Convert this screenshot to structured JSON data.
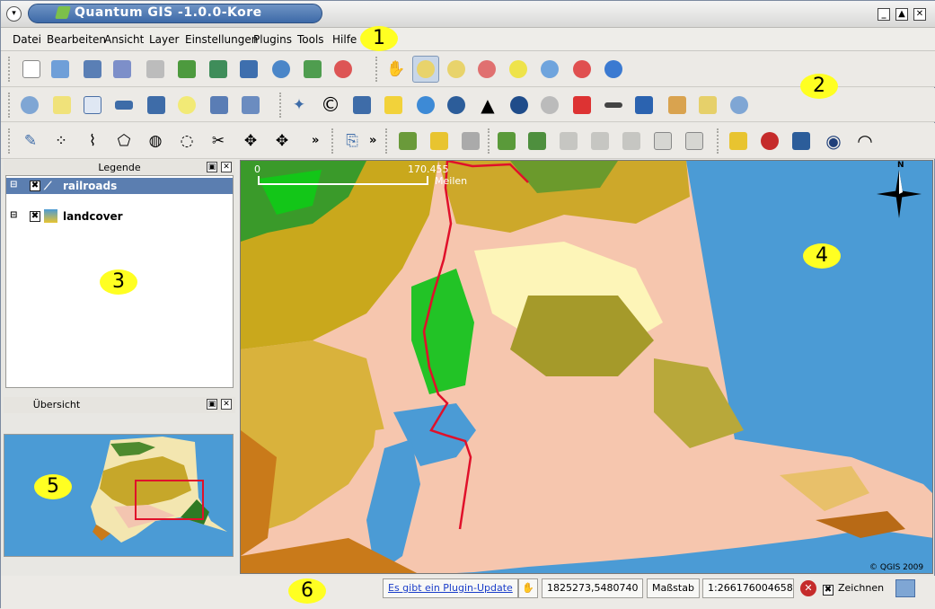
{
  "window": {
    "title": "Quantum GIS -1.0.0-Kore",
    "minimize_icon": "minimize-icon",
    "maximize_icon": "maximize-icon",
    "close_icon": "close-icon"
  },
  "menubar": {
    "items": [
      "Datei",
      "Bearbeiten",
      "Ansicht",
      "Layer",
      "Einstellungen",
      "Plugins",
      "Tools",
      "Hilfe"
    ]
  },
  "toolbars": {
    "row1_file": [
      "new-project-icon",
      "open-project-icon",
      "save-project-icon",
      "save-as-icon",
      "print-icon",
      "add-vector-icon",
      "add-raster-icon",
      "add-postgis-icon",
      "add-wms-icon",
      "add-spatialite-icon",
      "new-layer-icon"
    ],
    "row1_nav": [
      "pan-icon",
      "zoom-in-icon",
      "zoom-out-icon",
      "zoom-full-icon",
      "zoom-selection-icon",
      "zoom-layer-icon",
      "zoom-last-icon",
      "refresh-icon"
    ],
    "row2": [
      "identify-icon",
      "select-icon",
      "attribute-table-icon",
      "measure-line-icon",
      "measure-area-icon",
      "map-tips-icon",
      "new-bookmark-icon",
      "show-bookmarks-icon",
      "north-arrow-plugin-icon",
      "copyright-plugin-icon",
      "scalebar-plugin-icon",
      "d2s-plugin-icon",
      "globe-plugin-icon",
      "grid-plugin-icon",
      "graph-plugin-icon",
      "north-plugin-icon",
      "gdal-plugin-icon",
      "pdf-plugin-icon",
      "scale-plugin-icon",
      "vehicle-plugin-icon",
      "georeferencer-icon",
      "edit-icon",
      "search-plugin-icon"
    ],
    "row3_digitize": [
      "toggle-edit-icon",
      "capture-point-icon",
      "capture-line-icon",
      "capture-polygon-icon",
      "add-ring-icon",
      "add-island-icon",
      "split-feature-icon",
      "move-vertex-icon",
      "move-feature-icon"
    ],
    "row3_more_label": "»",
    "row3_plugins": [
      "plugin-manager-icon",
      "more-icon",
      "layer-tools-a-icon",
      "layer-tools-b-icon",
      "layer-tools-c-icon",
      "layer-add-icon",
      "layer-add-b-icon",
      "layer-hide-icon",
      "layer-pencil-icon",
      "layer-tool-icon",
      "layer-copy-icon",
      "layer-paste-icon",
      "star-layer-icon",
      "remove-layer-icon",
      "toggle-layer-icon",
      "eye-icon",
      "hidden-eye-icon"
    ],
    "row3_more2_label": "»"
  },
  "legend_panel": {
    "title": "Legende",
    "layers": [
      {
        "name": "railroads",
        "checked": "✖",
        "selected": true
      },
      {
        "name": "landcover",
        "checked": "✖",
        "selected": false
      }
    ]
  },
  "overview_panel": {
    "title": "Übersicht"
  },
  "map": {
    "scalebar_start": "0",
    "scalebar_end": "170.455",
    "scalebar_unit": "Meilen",
    "north_label": "N",
    "copyright": "© QGIS 2009"
  },
  "status": {
    "plugin_update": "Es gibt ein Plugin-Update",
    "coordinates": "1825273,5480740",
    "scale_label": "Maßstab",
    "scale_value": "1:266176004658",
    "render_checked": "✖",
    "render_label": "Zeichnen"
  },
  "callouts": [
    "1",
    "2",
    "3",
    "4",
    "5",
    "6"
  ],
  "colors": {
    "title_bar": "#3d6aa8",
    "water": "#4b9bd5",
    "railroad": "#e0102a",
    "callout": "#ffff22"
  }
}
